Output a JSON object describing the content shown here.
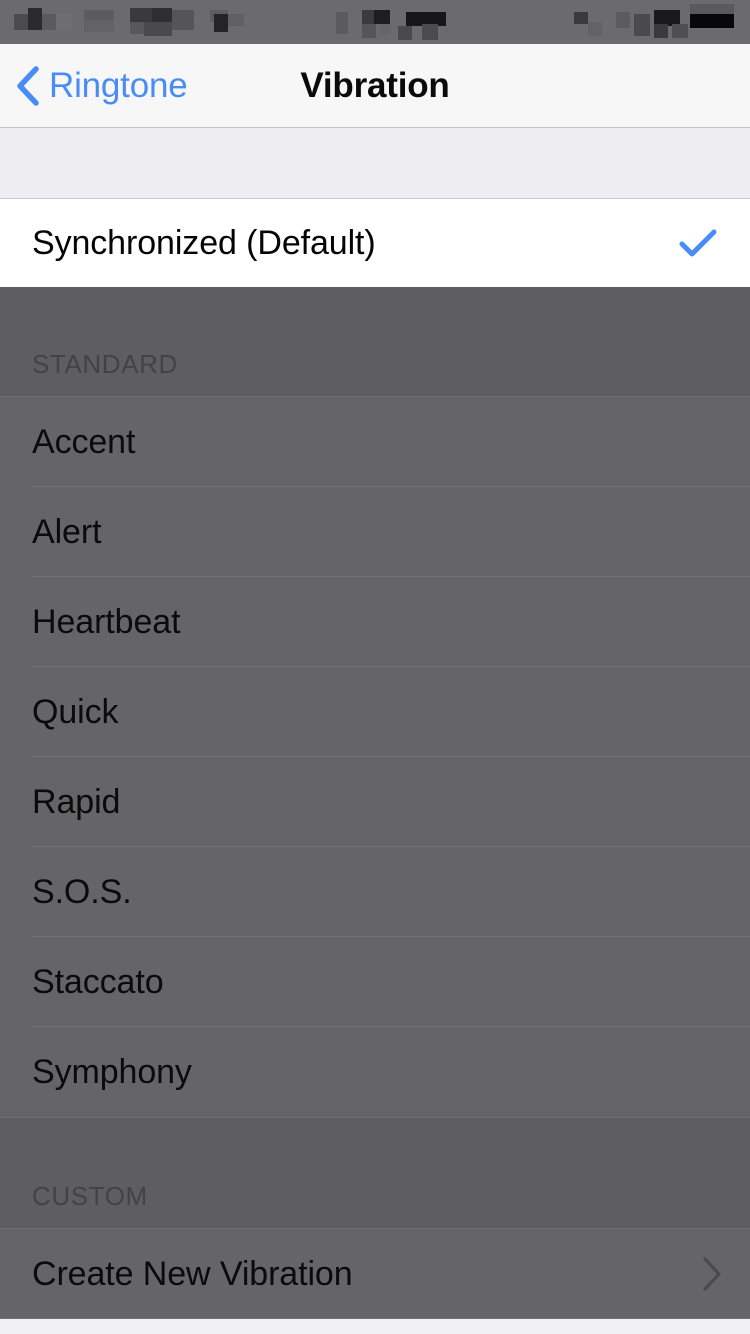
{
  "status_bar": {
    "redacted": true,
    "note": "pixelated",
    "background": "#6b6b6d"
  },
  "nav": {
    "back_label": "Ringtone",
    "back_icon": "chevron-left-icon",
    "title": "Vibration",
    "accent_color": "#4a8cf5",
    "background": "#f7f7f7"
  },
  "selected_section": {
    "rows": [
      {
        "label": "Synchronized (Default)",
        "checked": true,
        "check_icon": "checkmark-icon"
      }
    ]
  },
  "sections": [
    {
      "header": "STANDARD",
      "rows": [
        {
          "label": "Accent"
        },
        {
          "label": "Alert"
        },
        {
          "label": "Heartbeat"
        },
        {
          "label": "Quick"
        },
        {
          "label": "Rapid"
        },
        {
          "label": "S.O.S."
        },
        {
          "label": "Staccato"
        },
        {
          "label": "Symphony"
        }
      ]
    },
    {
      "header": "CUSTOM",
      "rows": [
        {
          "label": "Create New Vibration",
          "accessory": "chevron-right-icon"
        }
      ]
    }
  ],
  "colors": {
    "dim_overlay": "#5e5e60",
    "row_dim": "#656567",
    "separator": "#737375",
    "table_background": "#efeff4",
    "accent_blue": "#4a8cf5",
    "text_primary": "#0b0b0b",
    "header_text": "#434345"
  }
}
